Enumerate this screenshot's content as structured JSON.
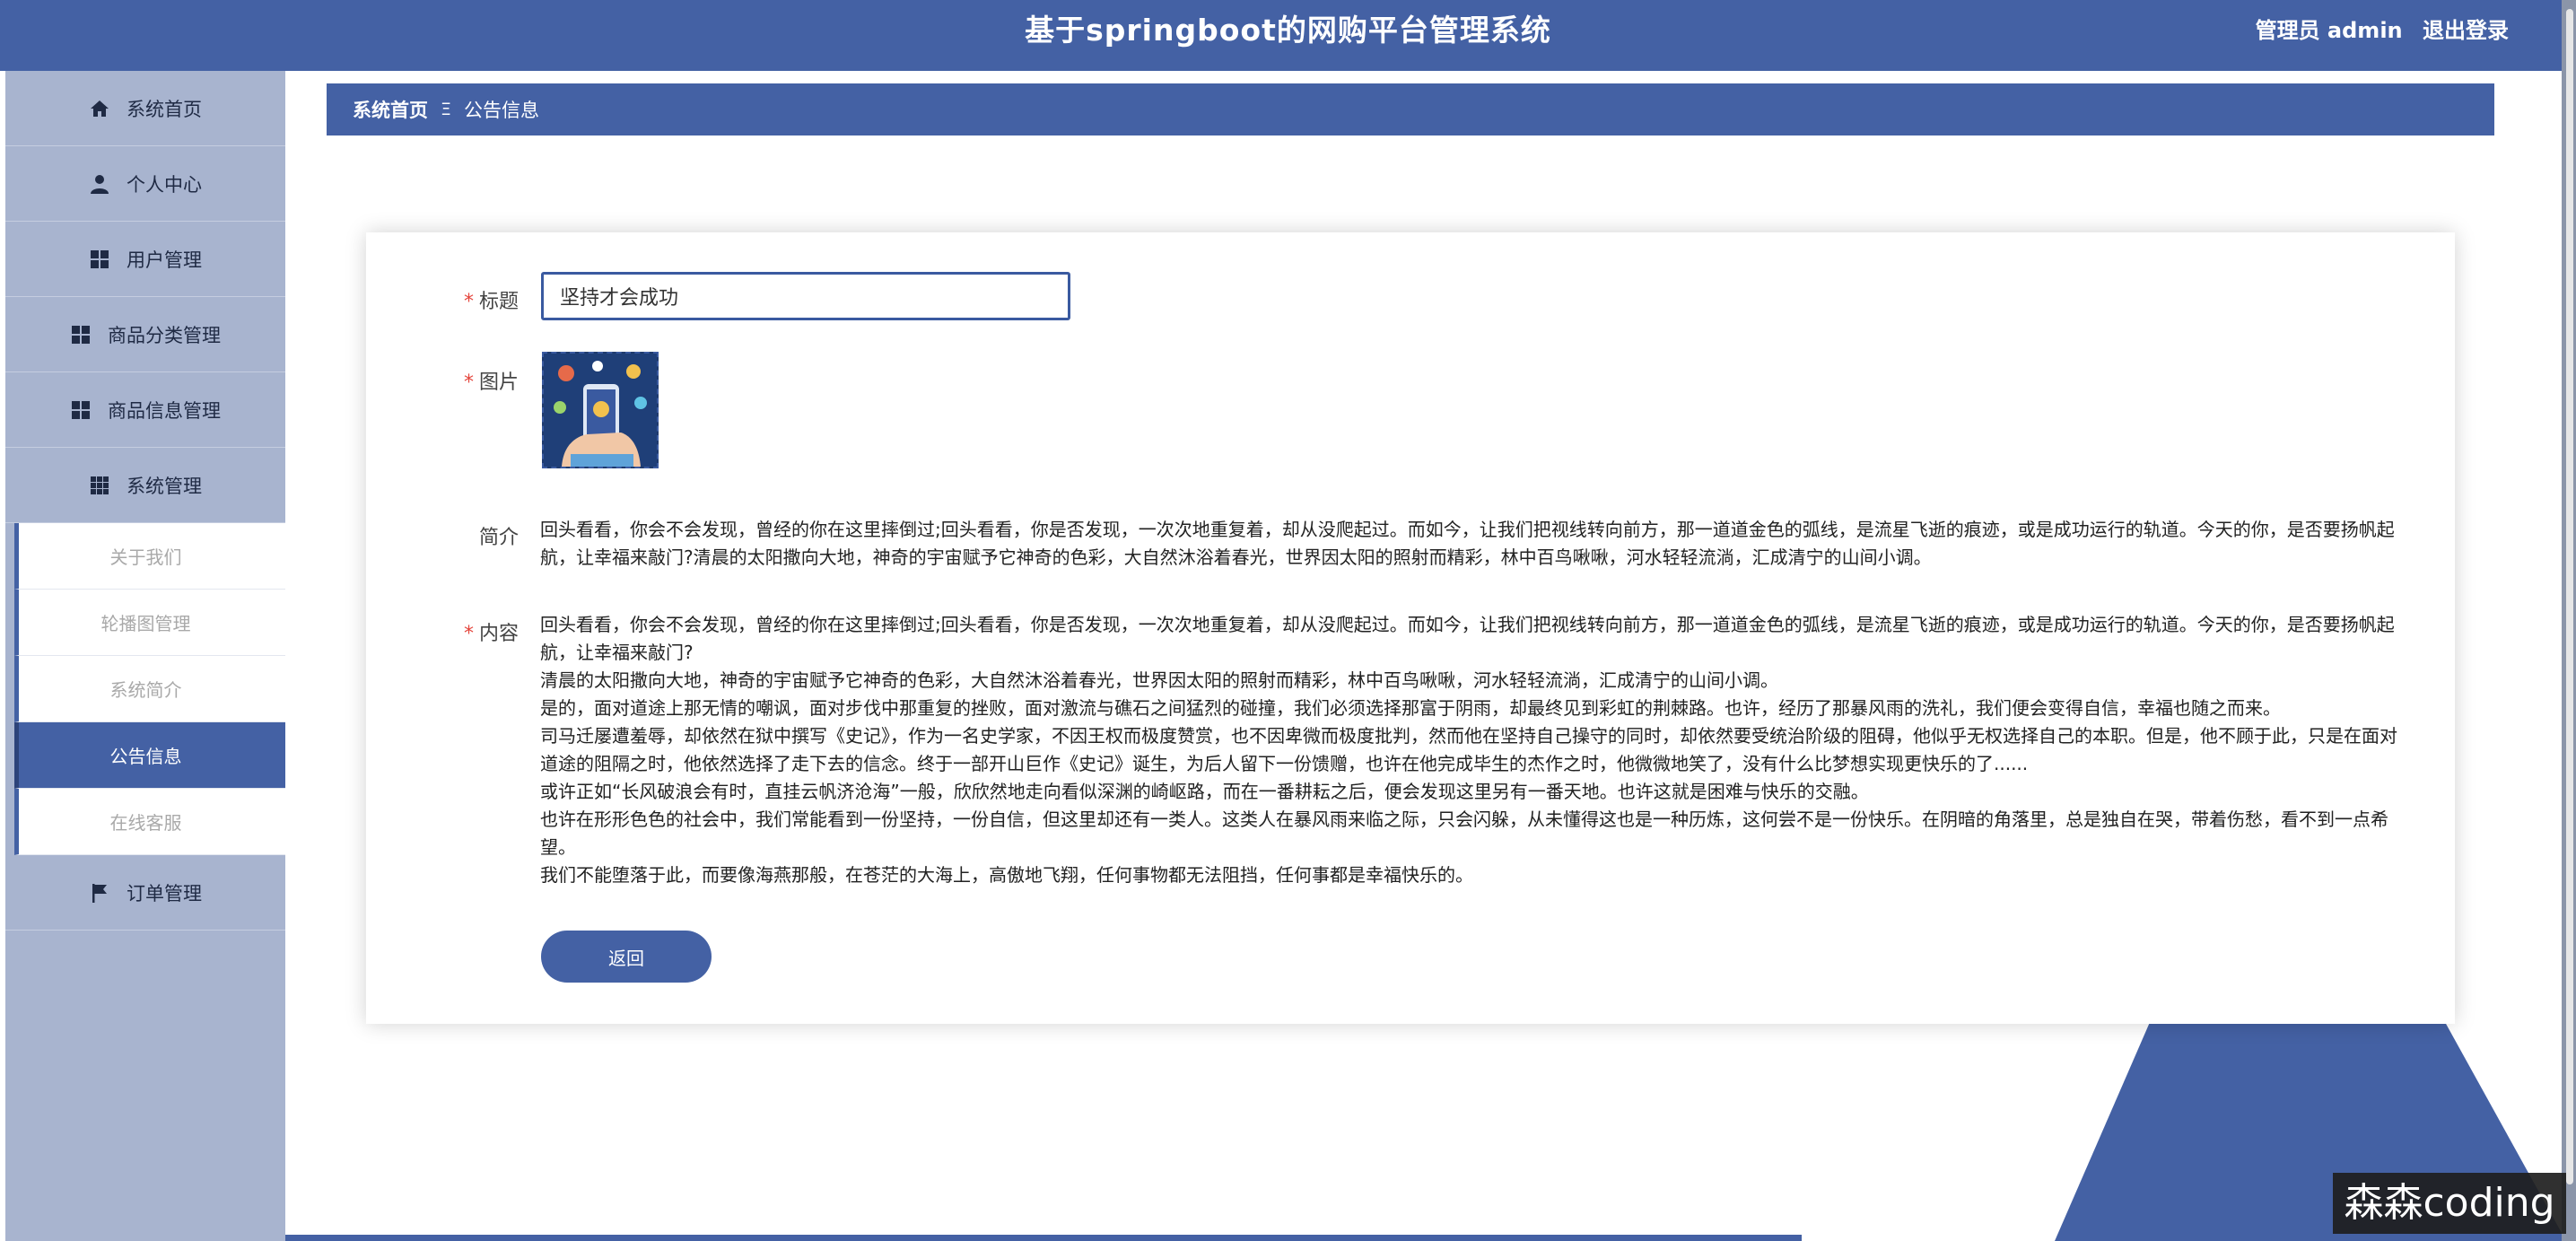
{
  "header": {
    "title": "基于springboot的网购平台管理系统",
    "user_label": "管理员 admin",
    "logout": "退出登录"
  },
  "sidebar": {
    "items": [
      {
        "label": "系统首页",
        "icon": "home-icon"
      },
      {
        "label": "个人中心",
        "icon": "user-icon"
      },
      {
        "label": "用户管理",
        "icon": "grid-icon"
      },
      {
        "label": "商品分类管理",
        "icon": "grid-icon"
      },
      {
        "label": "商品信息管理",
        "icon": "grid-icon"
      },
      {
        "label": "系统管理",
        "icon": "apps-icon"
      }
    ],
    "sub_items": [
      "关于我们",
      "轮播图管理",
      "系统简介",
      "公告信息",
      "在线客服"
    ],
    "active_sub": "公告信息",
    "last_item": {
      "label": "订单管理",
      "icon": "flag-icon"
    }
  },
  "breadcrumb": {
    "home": "系统首页",
    "separator": "Ξ",
    "current": "公告信息"
  },
  "form": {
    "title_label": "标题",
    "title_value": "坚持才会成功",
    "image_label": "图片",
    "intro_label": "简介",
    "intro_text": "回头看看，你会不会发现，曾经的你在这里摔倒过;回头看看，你是否发现，一次次地重复着，却从没爬起过。而如今，让我们把视线转向前方，那一道道金色的弧线，是流星飞逝的痕迹，或是成功运行的轨道。今天的你，是否要扬帆起航，让幸福来敲门?清晨的太阳撒向大地，神奇的宇宙赋予它神奇的色彩，大自然沐浴着春光，世界因太阳的照射而精彩，林中百鸟啾啾，河水轻轻流淌，汇成清宁的山间小调。",
    "content_label": "内容",
    "content_paragraphs": [
      "回头看看，你会不会发现，曾经的你在这里摔倒过;回头看看，你是否发现，一次次地重复着，却从没爬起过。而如今，让我们把视线转向前方，那一道道金色的弧线，是流星飞逝的痕迹，或是成功运行的轨道。今天的你，是否要扬帆起航，让幸福来敲门?",
      "清晨的太阳撒向大地，神奇的宇宙赋予它神奇的色彩，大自然沐浴着春光，世界因太阳的照射而精彩，林中百鸟啾啾，河水轻轻流淌，汇成清宁的山间小调。",
      "是的，面对道途上那无情的嘲讽，面对步伐中那重复的挫败，面对激流与礁石之间猛烈的碰撞，我们必须选择那富于阴雨，却最终见到彩虹的荆棘路。也许，经历了那暴风雨的洗礼，我们便会变得自信，幸福也随之而来。",
      "司马迁屡遭羞辱，却依然在狱中撰写《史记》，作为一名史学家，不因王权而极度赞赏，也不因卑微而极度批判，然而他在坚持自己操守的同时，却依然要受统治阶级的阻碍，他似乎无权选择自己的本职。但是，他不顾于此，只是在面对道途的阻隔之时，他依然选择了走下去的信念。终于一部开山巨作《史记》诞生，为后人留下一份馈赠，也许在他完成毕生的杰作之时，他微微地笑了，没有什么比梦想实现更快乐的了......",
      "或许正如“长风破浪会有时，直挂云帆济沧海”一般，欣欣然地走向看似深渊的崎岖路，而在一番耕耘之后，便会发现这里另有一番天地。也许这就是困难与快乐的交融。",
      "也许在形形色色的社会中，我们常能看到一份坚持，一份自信，但这里却还有一类人。这类人在暴风雨来临之际，只会闪躲，从未懂得这也是一种历炼，这何尝不是一份快乐。在阴暗的角落里，总是独自在哭，带着伤愁，看不到一点希望。",
      "我们不能堕落于此，而要像海燕那般，在苍茫的大海上，高傲地飞翔，任何事物都无法阻挡，任何事都是幸福快乐的。"
    ],
    "back_button": "返回"
  },
  "watermark": "森森coding",
  "colors": {
    "primary": "#4461a4",
    "sidebar_bg": "#a8b4cf",
    "required": "#e4453c"
  }
}
